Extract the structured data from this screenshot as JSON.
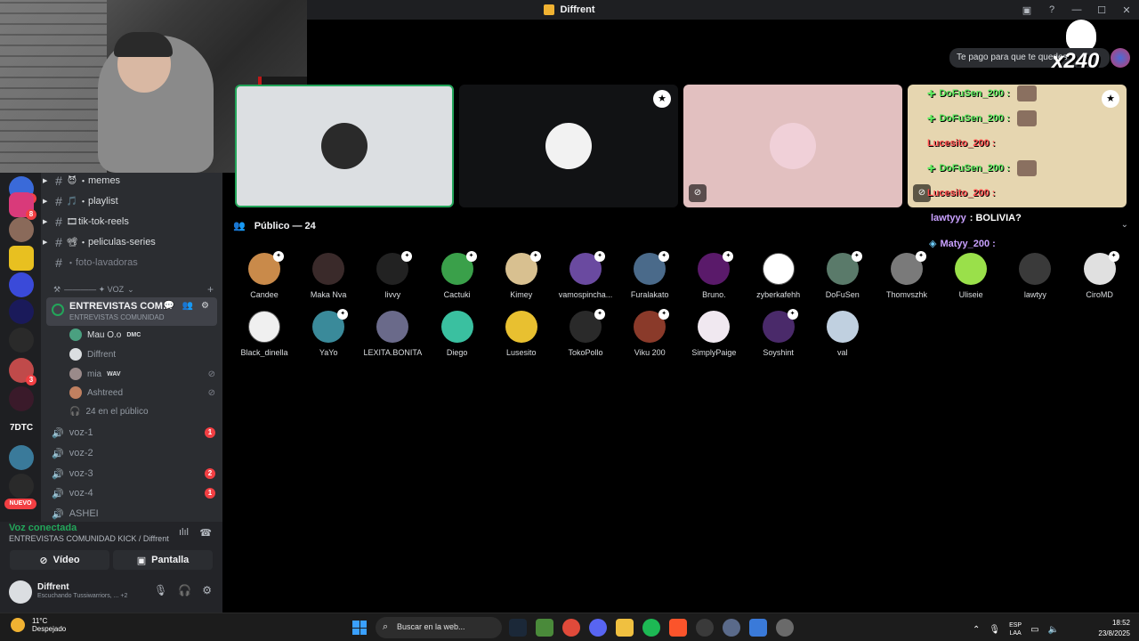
{
  "window": {
    "title": "Diffrent",
    "controls": [
      "▣",
      "?",
      "—",
      "☐",
      "✕"
    ]
  },
  "servers": {
    "badges": [
      "8",
      "8",
      "3"
    ],
    "labels": [
      "7DTC"
    ],
    "new_label": "NUEVO"
  },
  "channels": {
    "text": [
      {
        "name": "memes",
        "emoji": "😈",
        "prefix": "・"
      },
      {
        "name": "playlist",
        "emoji": "🎵",
        "prefix": "・"
      },
      {
        "name": "tik-tok-reels",
        "emoji": "🎞",
        "prefix": ""
      },
      {
        "name": "peliculas-series",
        "emoji": "📽",
        "prefix": "・"
      },
      {
        "name": "foto-lavadoras",
        "emoji": "",
        "prefix": "・"
      }
    ],
    "voice_category": "———— ✦ VOZ",
    "active_voice": {
      "name": "ENTREVISTAS COMUNI...",
      "subtitle": "ENTREVISTAS COMUNIDAD",
      "actions": "💬 👥 ⚙"
    },
    "voice_users": [
      {
        "name": "Mau O.o",
        "tag": "DMC",
        "muted": false,
        "dim": false
      },
      {
        "name": "Diffrent",
        "tag": "",
        "muted": false,
        "dim": true
      },
      {
        "name": "mia",
        "tag": "WAV",
        "muted": true,
        "dim": true
      },
      {
        "name": "Ashtreed",
        "tag": "",
        "muted": true,
        "dim": true
      }
    ],
    "audience_label": "24 en el público",
    "voice_channels": [
      {
        "name": "voz-1",
        "count": "1"
      },
      {
        "name": "voz-2",
        "count": ""
      },
      {
        "name": "voz-3",
        "count": "2"
      },
      {
        "name": "voz-4",
        "count": "1"
      },
      {
        "name": "ASHEI",
        "count": ""
      }
    ]
  },
  "voice_panel": {
    "status": "Voz conectada",
    "location": "ENTREVISTAS COMUNIDAD KICK / Diffrent",
    "video_label": "Vídeo",
    "screen_label": "Pantalla"
  },
  "user_panel": {
    "name": "Diffrent",
    "activity": "Escuchando Tussiwarriors, ...",
    "extra": "+2"
  },
  "stage": {
    "chat_bubble": "Te pago para que te quedes",
    "overlay_text": "x240",
    "feed": [
      {
        "text": "DoFuSen_200 :",
        "color": "green",
        "plus": true
      },
      {
        "text": "DoFuSen_200 :",
        "color": "green",
        "plus": true
      },
      {
        "text": "Lucesito_200 :",
        "color": "red",
        "plus": false
      },
      {
        "text": "DoFuSen_200 :",
        "color": "green",
        "plus": true
      },
      {
        "text": "Lucesito_200 :",
        "color": "red",
        "plus": false
      }
    ],
    "float_chat": [
      {
        "user": "lawtyyy",
        "message": ": BOLIVIA?"
      },
      {
        "user": "Matyy_200 :",
        "message": ""
      }
    ],
    "public_header": "Público — 24",
    "members": [
      {
        "name": "Candee",
        "color": "#c98a4a",
        "badge": true
      },
      {
        "name": "Maka Nva",
        "color": "#3a2a2a",
        "badge": false
      },
      {
        "name": "livvy",
        "color": "#222",
        "badge": true
      },
      {
        "name": "Cactuki",
        "color": "#3aa04a",
        "badge": true
      },
      {
        "name": "Kimey",
        "color": "#d8c090",
        "badge": true
      },
      {
        "name": "vamospincha...",
        "color": "#6a4aa0",
        "badge": true
      },
      {
        "name": "Furalakato",
        "color": "#4a6a8a",
        "badge": true
      },
      {
        "name": "Bruno.",
        "color": "#5a1a6a",
        "badge": true
      },
      {
        "name": "zyberkafehh",
        "color": "#ffffff",
        "badge": false
      },
      {
        "name": "DoFuSen",
        "color": "#5a7a6a",
        "badge": true
      },
      {
        "name": "Thomvszhk",
        "color": "#7a7a7a",
        "badge": true
      },
      {
        "name": "Uliseie",
        "color": "#9ae04a",
        "badge": false
      },
      {
        "name": "lawtyy",
        "color": "#3a3a3a",
        "badge": false
      },
      {
        "name": "CiroMD",
        "color": "#e0e0e0",
        "badge": true
      },
      {
        "name": "Black_dinella",
        "color": "#f0f0f0",
        "badge": false
      },
      {
        "name": "YaYo",
        "color": "#3a8a9a",
        "badge": true
      },
      {
        "name": "LEXITA.BONITA",
        "color": "#6a6a8a",
        "badge": false
      },
      {
        "name": "Diego",
        "color": "#3ac0a0",
        "badge": false
      },
      {
        "name": "Lusesito",
        "color": "#e8c030",
        "badge": false
      },
      {
        "name": "TokoPollo",
        "color": "#2a2a2a",
        "badge": true
      },
      {
        "name": "Viku 200",
        "color": "#8a3a2a",
        "badge": true
      },
      {
        "name": "SimplyPaige",
        "color": "#f0e8f0",
        "badge": false
      },
      {
        "name": "Soyshint",
        "color": "#4a2a6a",
        "badge": true
      },
      {
        "name": "val",
        "color": "#c0d0e0",
        "badge": false
      }
    ]
  },
  "taskbar": {
    "temperature": "11°C",
    "condition": "Despejado",
    "search_placeholder": "Buscar en la web...",
    "lang_top": "ESP",
    "lang_bottom": "LAA",
    "time": "18:52",
    "date": "23/8/2025"
  },
  "colors": {
    "accent_green": "#23a55a",
    "alert_red": "#f23f43",
    "sidebar_bg": "#2b2d31"
  }
}
